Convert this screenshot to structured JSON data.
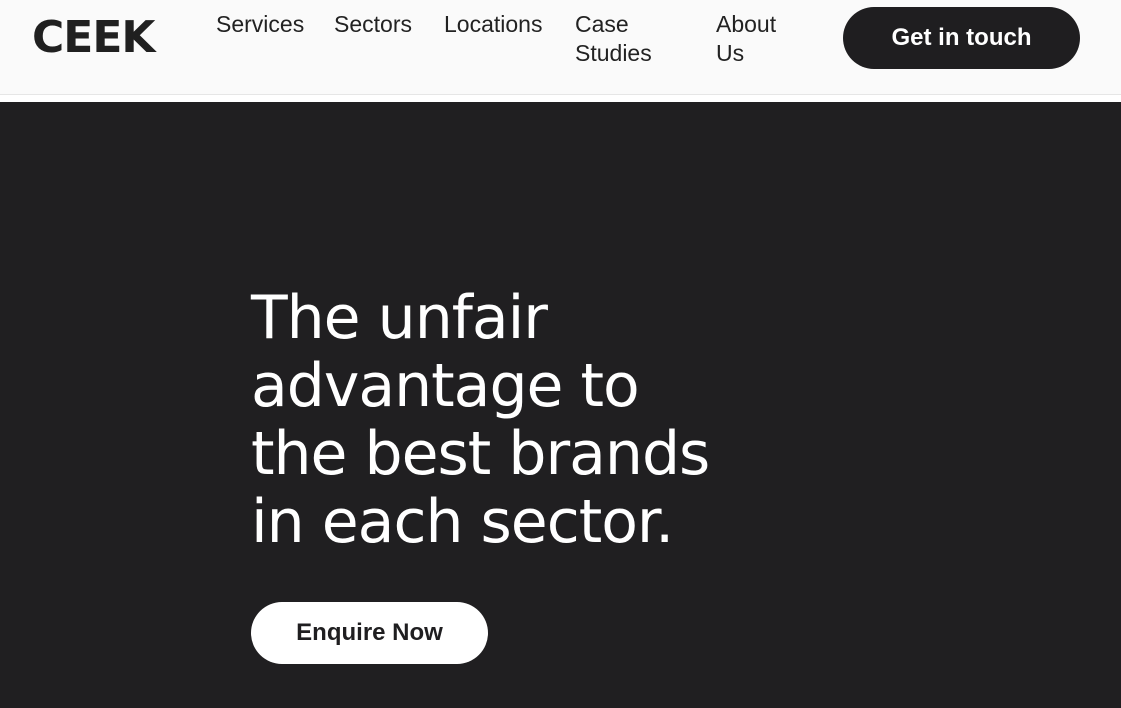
{
  "header": {
    "logo": "CEEK",
    "nav": {
      "services": "Services",
      "sectors": "Sectors",
      "locations": "Locations",
      "case_studies_line1": "Case",
      "case_studies_line2": "Studies",
      "about_line1": "About",
      "about_line2": "Us"
    },
    "cta_label": "Get in touch"
  },
  "hero": {
    "heading_lines": [
      "The unfair",
      "advantage to",
      "the best brands",
      "in each sector."
    ],
    "button_label": "Enquire Now"
  },
  "colors": {
    "header_bg": "#fafafa",
    "hero_bg": "#201f21",
    "dark_button": "#1f1e20",
    "light_button": "#ffffff"
  }
}
